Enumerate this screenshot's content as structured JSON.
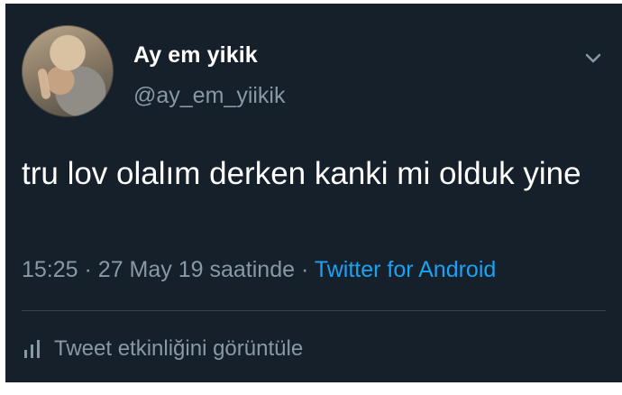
{
  "tweet": {
    "display_name": "Ay em yikik",
    "handle": "@ay_em_yiikik",
    "text": "tru lov olalım derken kanki mi olduk yine",
    "time": "15:25",
    "date": "27 May 19",
    "date_suffix": "saatinde",
    "source": "Twitter for Android",
    "activity_label": "Tweet etkinliğini görüntüle",
    "icons": {
      "menu": "chevron-down-icon",
      "activity": "bar-chart-icon"
    }
  },
  "theme": {
    "background": "#15202b",
    "text": "#ffffff",
    "secondary": "#8899a6",
    "link": "#1da1f2",
    "divider": "#38444d"
  }
}
